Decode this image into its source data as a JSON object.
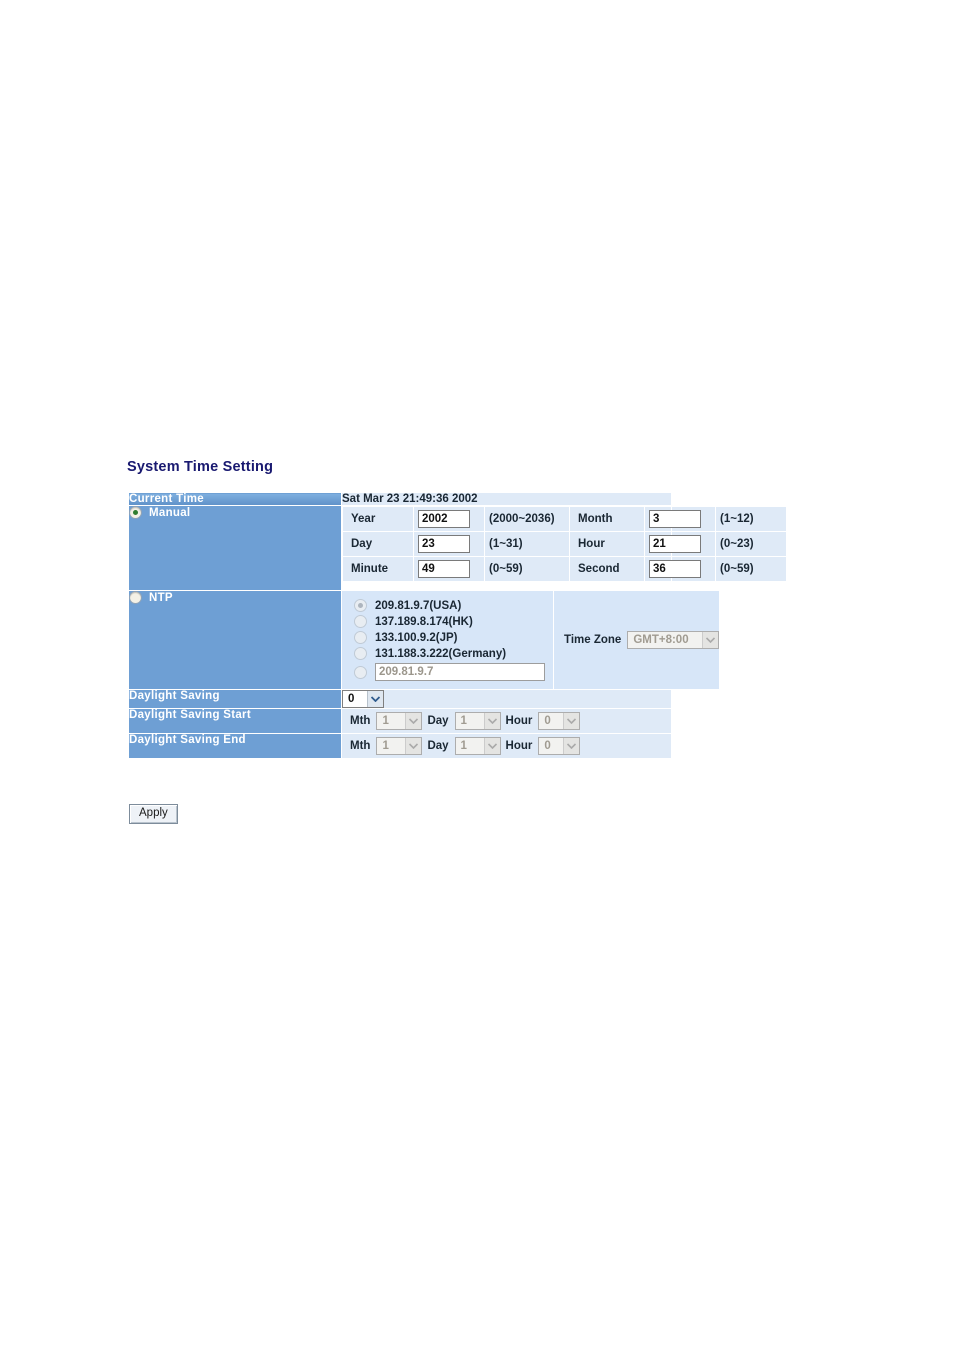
{
  "page": {
    "title": "System Time Setting"
  },
  "current_time": {
    "label": "Current Time",
    "value": "Sat Mar 23 21:49:36 2002"
  },
  "manual": {
    "label": "Manual",
    "radio_state": "checked",
    "fields": [
      {
        "label": "Year",
        "value": "2002",
        "range": "(2000~2036)"
      },
      {
        "label": "Month",
        "value": "3",
        "range": "(1~12)"
      },
      {
        "label": "Day",
        "value": "23",
        "range": "(1~31)"
      },
      {
        "label": "Hour",
        "value": "21",
        "range": "(0~23)"
      },
      {
        "label": "Minute",
        "value": "49",
        "range": "(0~59)"
      },
      {
        "label": "Second",
        "value": "36",
        "range": "(0~59)"
      }
    ]
  },
  "ntp": {
    "label": "NTP",
    "radio_state": "unchecked",
    "servers": [
      {
        "label": "209.81.9.7(USA)",
        "selected": true
      },
      {
        "label": "137.189.8.174(HK)",
        "selected": false
      },
      {
        "label": "133.100.9.2(JP)",
        "selected": false
      },
      {
        "label": "131.188.3.222(Germany)",
        "selected": false
      }
    ],
    "custom_server": {
      "value": "209.81.9.7",
      "selected": false
    },
    "time_zone": {
      "label": "Time Zone",
      "value": "GMT+8:00",
      "disabled": true
    }
  },
  "daylight_saving": {
    "label": "Daylight Saving",
    "value": "0"
  },
  "daylight_saving_start": {
    "label": "Daylight Saving Start",
    "month_label": "Mth",
    "month_value": "1",
    "day_label": "Day",
    "day_value": "1",
    "hour_label": "Hour",
    "hour_value": "0"
  },
  "daylight_saving_end": {
    "label": "Daylight Saving End",
    "month_label": "Mth",
    "month_value": "1",
    "day_label": "Day",
    "day_value": "1",
    "hour_label": "Hour",
    "hour_value": "0"
  },
  "actions": {
    "apply_label": "Apply"
  },
  "colors": {
    "header_blue": "#6e9fd4",
    "value_blue": "#dfeaf7",
    "section_blue": "#d7e6f8",
    "title_navy": "#191970",
    "border_gray": "#9aa8b5"
  }
}
